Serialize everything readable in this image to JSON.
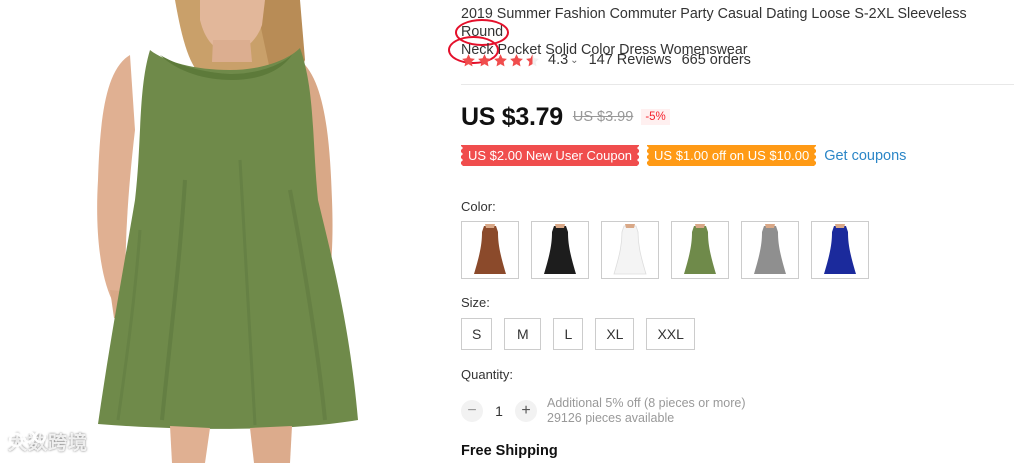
{
  "product": {
    "title_before": "2019 Summer Fashion Commuter Party Casual Dating Loose S-2XL Sleeveless ",
    "title_round": "Round",
    "title_neck": "Neck",
    "title_after": " Pocket Solid Color Dress Womenswear",
    "image_color": "#6f8a4a"
  },
  "rating": {
    "value": "4.3",
    "stars": 4.5,
    "star_color": "#f04d4d",
    "reviews": "147 Reviews",
    "orders": "665 orders"
  },
  "price": {
    "current": "US $3.79",
    "original": "US $3.99",
    "discount": "-5%"
  },
  "coupons": {
    "new_user": "US $2.00 New User Coupon",
    "threshold": "US $1.00 off on US $10.00",
    "get_link": "Get coupons"
  },
  "color": {
    "label": "Color:",
    "options": [
      {
        "name": "brown-dress",
        "hex": "#8b4a2b"
      },
      {
        "name": "black-dress",
        "hex": "#1d1d1d"
      },
      {
        "name": "white-dress",
        "hex": "#f4f4f4"
      },
      {
        "name": "green-dress",
        "hex": "#6f8a4a"
      },
      {
        "name": "gray-dress",
        "hex": "#8f8f8f"
      },
      {
        "name": "blue-dress",
        "hex": "#1b2a9c"
      }
    ]
  },
  "size": {
    "label": "Size:",
    "options": [
      "S",
      "M",
      "L",
      "XL",
      "XXL"
    ]
  },
  "quantity": {
    "label": "Quantity:",
    "value": "1",
    "minus": "−",
    "plus": "+",
    "note_line1": "Additional 5% off (8 pieces or more)",
    "note_line2": "29126 pieces available"
  },
  "shipping": {
    "label": "Free Shipping"
  },
  "watermark": {
    "text": "大数跨境"
  }
}
